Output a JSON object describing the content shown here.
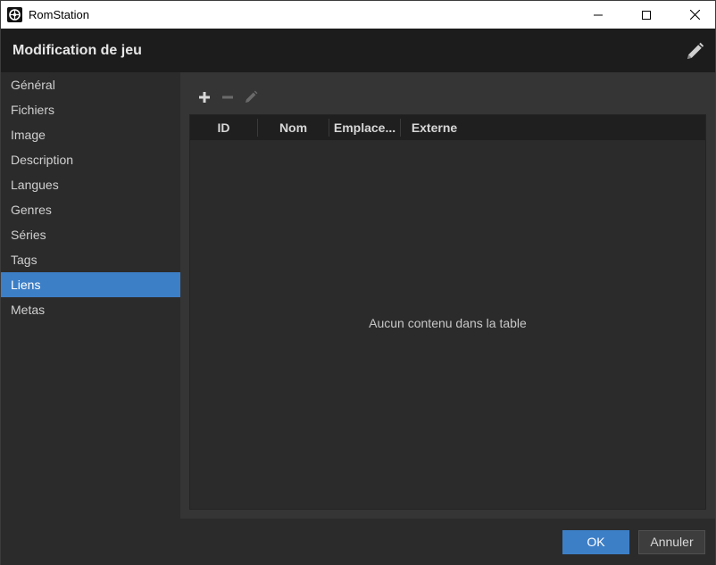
{
  "window": {
    "title": "RomStation"
  },
  "header": {
    "title": "Modification de jeu"
  },
  "sidebar": {
    "items": [
      {
        "label": "Général"
      },
      {
        "label": "Fichiers"
      },
      {
        "label": "Image"
      },
      {
        "label": "Description"
      },
      {
        "label": "Langues"
      },
      {
        "label": "Genres"
      },
      {
        "label": "Séries"
      },
      {
        "label": "Tags"
      },
      {
        "label": "Liens"
      },
      {
        "label": "Metas"
      }
    ],
    "active_label": "Liens"
  },
  "toolbar": {
    "icons": [
      "plus-icon",
      "minus-icon",
      "pencil-icon"
    ]
  },
  "table": {
    "columns": [
      "ID",
      "Nom",
      "Emplace...",
      "Externe"
    ],
    "empty_message": "Aucun contenu dans la table"
  },
  "footer": {
    "ok_label": "OK",
    "cancel_label": "Annuler"
  },
  "colors": {
    "accent": "#3d7fc7",
    "background": "#2b2b2b",
    "header_bg": "#1c1c1c"
  }
}
